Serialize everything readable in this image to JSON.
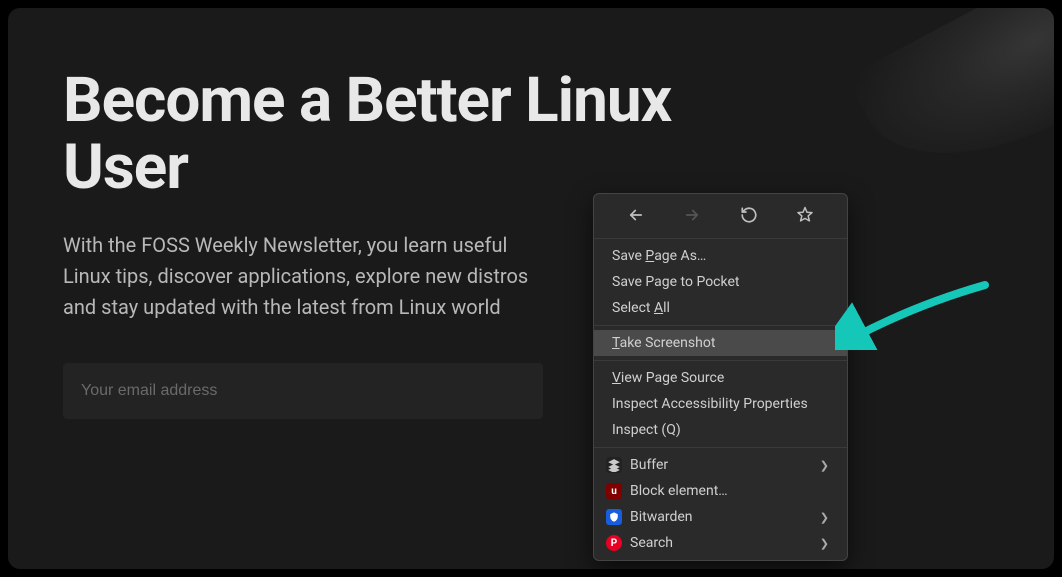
{
  "page": {
    "heading": "Become a Better Linux User",
    "subtext": "With the FOSS Weekly Newsletter, you learn useful Linux tips, discover applications, explore new distros and stay updated with the latest from Linux world",
    "email_placeholder": "Your email address"
  },
  "context_menu": {
    "sections": [
      {
        "items": [
          {
            "label": "Save Page As…",
            "underline_index": 5
          },
          {
            "label": "Save Page to Pocket"
          },
          {
            "label": "Select All",
            "underline_index": 7
          }
        ]
      },
      {
        "items": [
          {
            "label": "Take Screenshot",
            "underline_index": 0,
            "highlighted": true
          }
        ]
      },
      {
        "items": [
          {
            "label": "View Page Source",
            "underline_index": 0
          },
          {
            "label": "Inspect Accessibility Properties"
          },
          {
            "label": "Inspect (Q)"
          }
        ]
      },
      {
        "items": [
          {
            "label": "Buffer",
            "icon": "buffer",
            "submenu": true
          },
          {
            "label": "Block element…",
            "icon": "ublock"
          },
          {
            "label": "Bitwarden",
            "icon": "bitwarden",
            "submenu": true
          },
          {
            "label": "Search",
            "icon": "pinterest",
            "submenu": true
          }
        ]
      }
    ]
  },
  "annotation": {
    "arrow_color": "#14c7b8"
  }
}
